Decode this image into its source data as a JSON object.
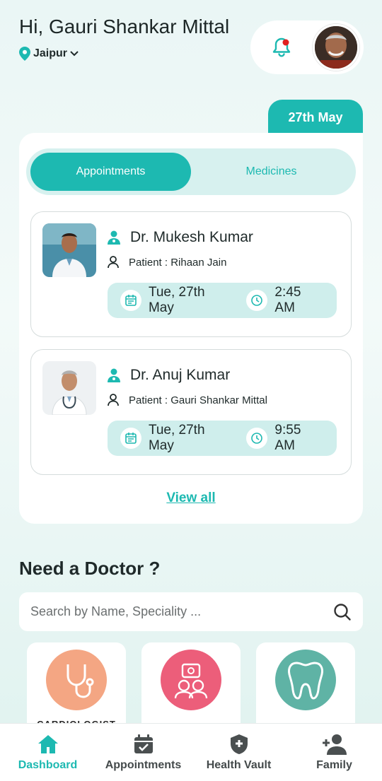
{
  "header": {
    "greeting": "Hi, Gauri Shankar Mittal",
    "location": "Jaipur"
  },
  "date_tab": "27th May",
  "tabs": [
    {
      "label": "Appointments",
      "active": true
    },
    {
      "label": "Medicines",
      "active": false
    }
  ],
  "appointments": [
    {
      "doctor": "Dr. Mukesh Kumar",
      "patient": "Patient : Rihaan Jain",
      "date": "Tue, 27th May",
      "time": "2:45 AM"
    },
    {
      "doctor": "Dr. Anuj Kumar",
      "patient": "Patient : Gauri Shankar Mittal",
      "date": "Tue, 27th May",
      "time": "9:55 AM"
    }
  ],
  "view_all": "View all",
  "doctor_section": {
    "title": "Need a Doctor ?",
    "search_placeholder": "Search by Name, Speciality ..."
  },
  "specialities": [
    {
      "label": "CARDIOLOGIST",
      "icon": "stethoscope-icon",
      "color": "#f4a683"
    },
    {
      "label": "",
      "icon": "pediatric-icon",
      "color": "#ec5e7a"
    },
    {
      "label": "",
      "icon": "tooth-icon",
      "color": "#5fb3a5"
    }
  ],
  "nav": [
    {
      "label": "Dashboard",
      "icon": "home-icon",
      "active": true
    },
    {
      "label": "Appointments",
      "icon": "calendar-check-icon",
      "active": false
    },
    {
      "label": "Health Vault",
      "icon": "shield-plus-icon",
      "active": false
    },
    {
      "label": "Family",
      "icon": "add-user-icon",
      "active": false
    }
  ],
  "colors": {
    "accent": "#1db9b1",
    "accent_light": "#cfeeec",
    "notification": "#e02020"
  }
}
